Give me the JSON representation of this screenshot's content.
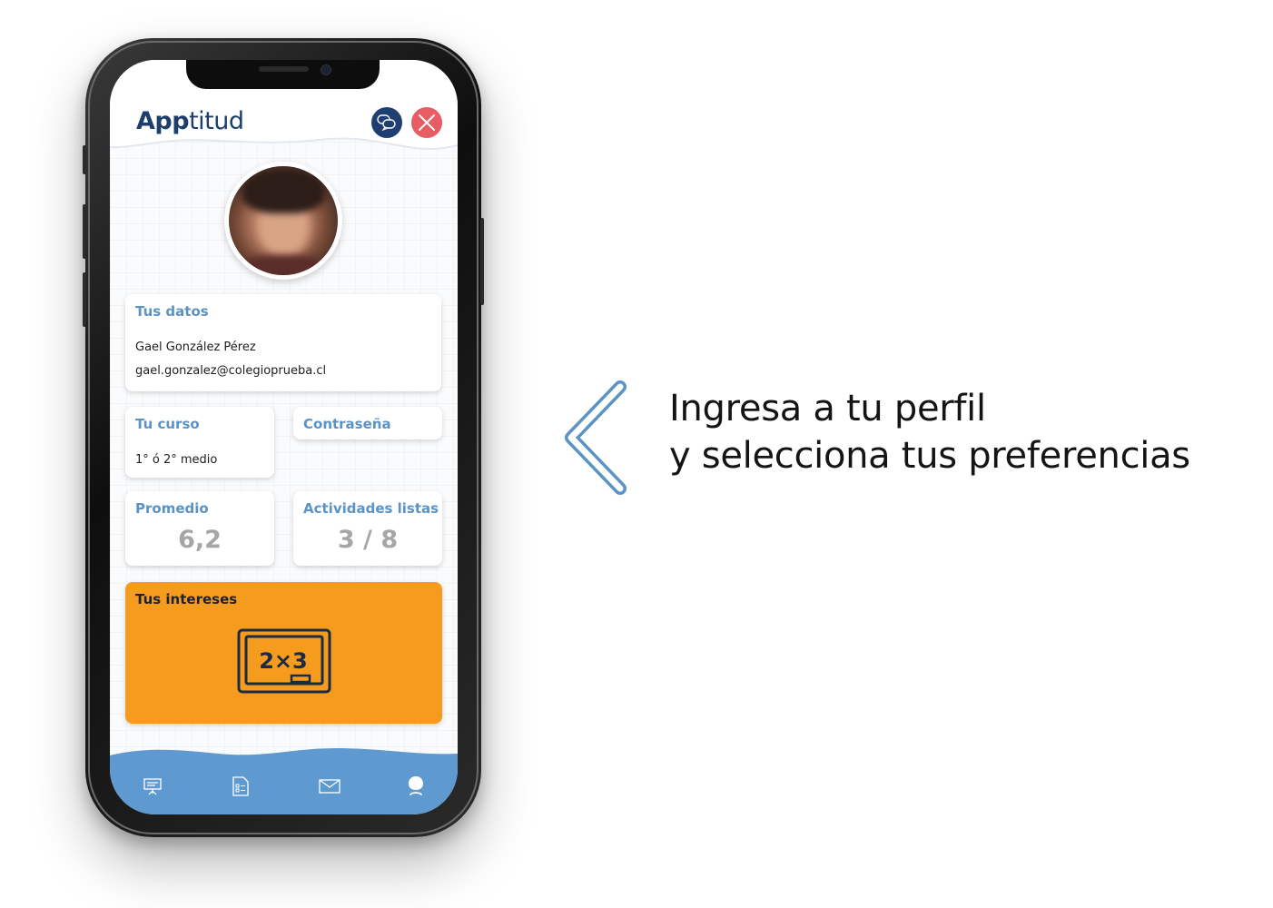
{
  "app": {
    "logo_bold": "App",
    "logo_light": "titud"
  },
  "profile": {
    "personal_data": {
      "title": "Tus datos",
      "name": "Gael González Pérez",
      "email": "gael.gonzalez@colegioprueba.cl"
    },
    "course": {
      "title": "Tu curso",
      "value": "1° ó 2° medio"
    },
    "password": {
      "title": "Contraseña"
    },
    "average": {
      "title": "Promedio",
      "value": "6,2"
    },
    "activities": {
      "title": "Actividades listas",
      "value": "3 / 8"
    },
    "interests": {
      "title": "Tus intereses",
      "icon": "math-board-icon",
      "board_text": "2×3"
    }
  },
  "bottom_nav": {
    "items": [
      "presentation-board-icon",
      "document-list-icon",
      "mail-icon",
      "profile-icon"
    ]
  },
  "callout": {
    "line1": "Ingresa a tu perfil",
    "line2": "y selecciona tus preferencias"
  },
  "colors": {
    "brand_navy": "#1f3f73",
    "title_blue": "#5b93c6",
    "close_red": "#e85c63",
    "interests_orange": "#f59c1f",
    "nav_blue": "#5e9ad0",
    "chevron_blue": "#5b93c6"
  }
}
